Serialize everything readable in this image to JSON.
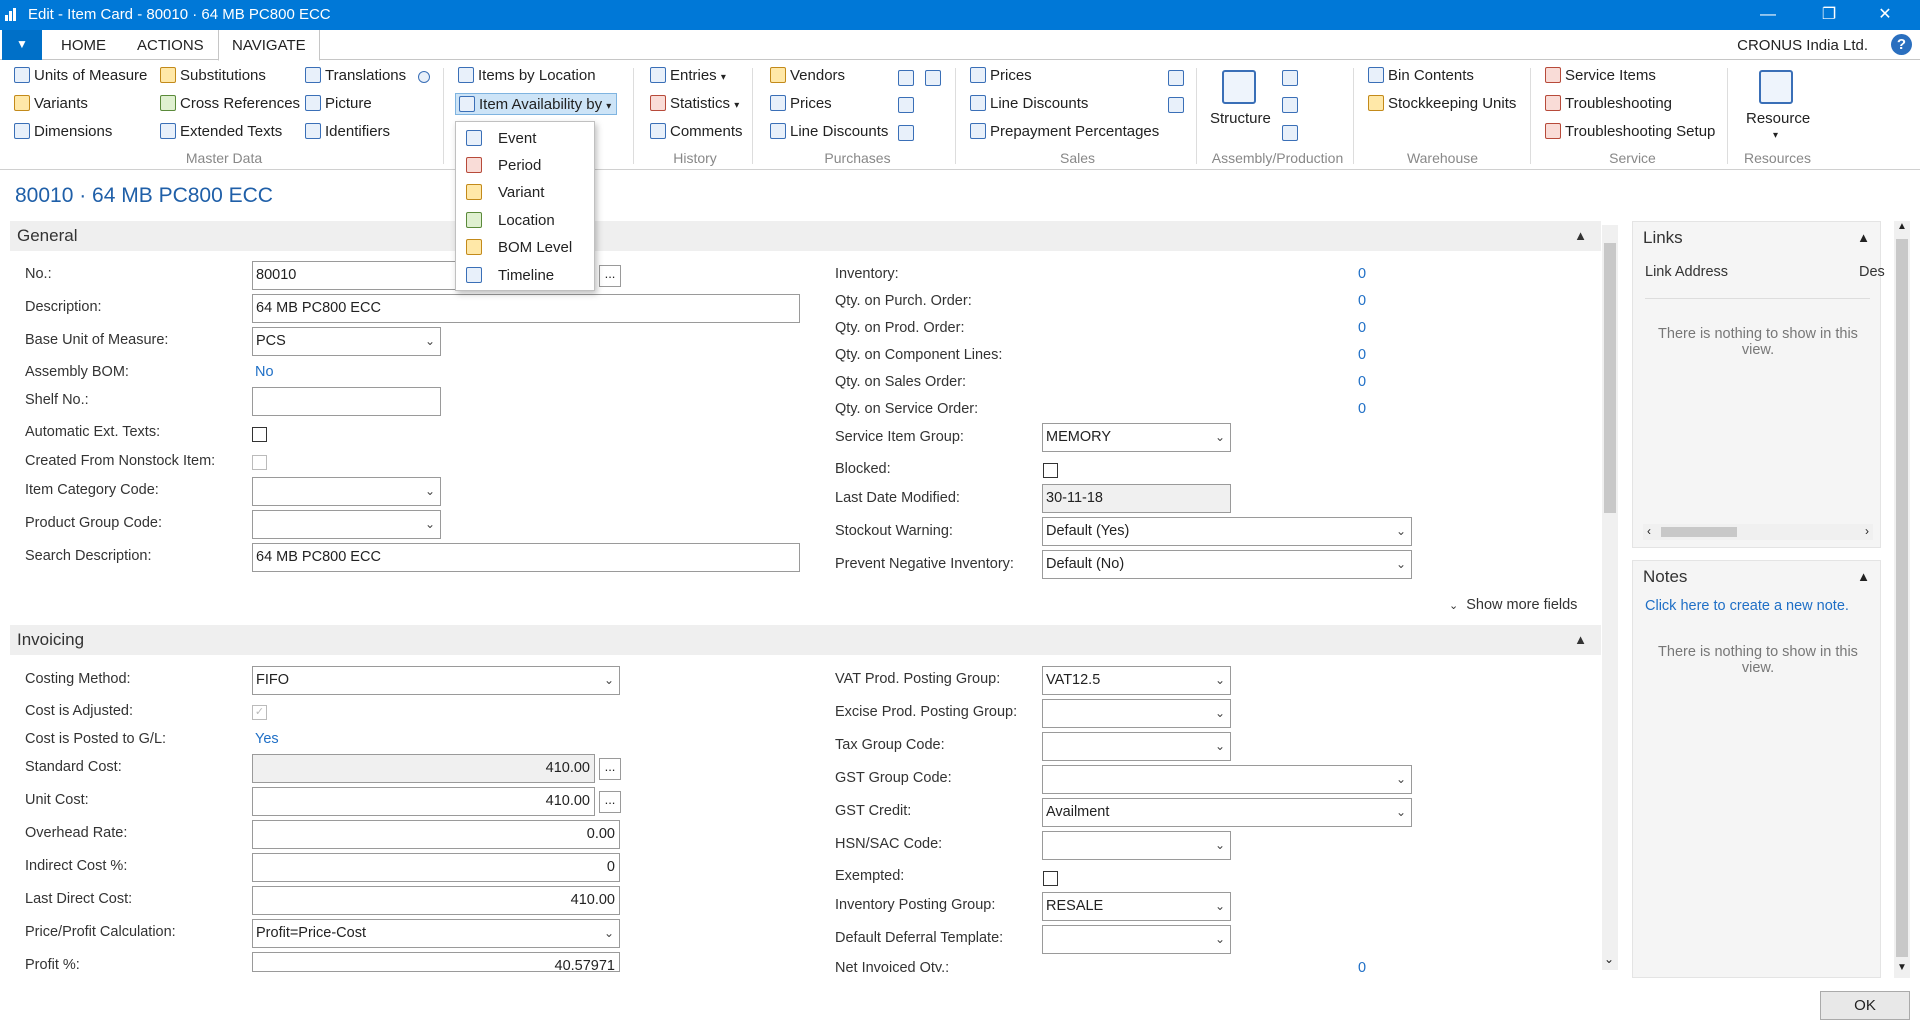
{
  "window": {
    "title": "Edit - Item Card - 80010 · 64 MB PC800 ECC",
    "minimize": "—",
    "restore": "❐",
    "close": "✕"
  },
  "menu": {
    "dropdown": "▼",
    "tabs": [
      "HOME",
      "ACTIONS",
      "NAVIGATE"
    ],
    "company": "CRONUS India Ltd.",
    "help": "?"
  },
  "ribbon": {
    "master_data": {
      "label": "Master Data",
      "items": [
        "Units of Measure",
        "Variants",
        "Dimensions",
        "Substitutions",
        "Cross References",
        "Extended Texts",
        "Translations",
        "Picture",
        "Identifiers"
      ]
    },
    "availability": {
      "items_by_location": "Items by Location",
      "item_availability_by": "Item Availability by"
    },
    "history": {
      "label": "History",
      "items": [
        "Entries",
        "Statistics",
        "Comments"
      ]
    },
    "purchases": {
      "label": "Purchases",
      "items": [
        "Vendors",
        "Prices",
        "Line Discounts"
      ]
    },
    "sales": {
      "label": "Sales",
      "items": [
        "Prices",
        "Line Discounts",
        "Prepayment Percentages"
      ]
    },
    "assembly": {
      "label": "Assembly/Production",
      "structure": "Structure"
    },
    "warehouse": {
      "label": "Warehouse",
      "items": [
        "Bin Contents",
        "Stockkeeping Units"
      ]
    },
    "service": {
      "label": "Service",
      "items": [
        "Service Items",
        "Troubleshooting",
        "Troubleshooting Setup"
      ]
    },
    "resources": {
      "label": "Resources",
      "resource": "Resource"
    }
  },
  "availability_menu": [
    "Event",
    "Period",
    "Variant",
    "Location",
    "BOM Level",
    "Timeline"
  ],
  "page_title": "80010 · 64 MB PC800 ECC",
  "general": {
    "header": "General",
    "no_label": "No.:",
    "no": "80010",
    "description_label": "Description:",
    "description": "64 MB PC800 ECC",
    "base_uom_label": "Base Unit of Measure:",
    "base_uom": "PCS",
    "assembly_bom_label": "Assembly BOM:",
    "assembly_bom": "No",
    "shelf_label": "Shelf No.:",
    "auto_ext_label": "Automatic Ext. Texts:",
    "nonstock_label": "Created From Nonstock Item:",
    "item_cat_label": "Item Category Code:",
    "prod_group_label": "Product Group Code:",
    "search_desc_label": "Search Description:",
    "search_desc": "64 MB PC800 ECC",
    "inventory_label": "Inventory:",
    "inventory": "0",
    "qty_purch_label": "Qty. on Purch. Order:",
    "qty_purch": "0",
    "qty_prod_label": "Qty. on Prod. Order:",
    "qty_prod": "0",
    "qty_comp_label": "Qty. on Component Lines:",
    "qty_comp": "0",
    "qty_sales_label": "Qty. on Sales Order:",
    "qty_sales": "0",
    "qty_service_label": "Qty. on Service Order:",
    "qty_service": "0",
    "service_group_label": "Service Item Group:",
    "service_group": "MEMORY",
    "blocked_label": "Blocked:",
    "last_modified_label": "Last Date Modified:",
    "last_modified": "30-11-18",
    "stockout_label": "Stockout Warning:",
    "stockout": "Default (Yes)",
    "prevent_neg_label": "Prevent Negative Inventory:",
    "prevent_neg": "Default (No)",
    "show_more": "Show more fields"
  },
  "invoicing": {
    "header": "Invoicing",
    "costing_label": "Costing Method:",
    "costing": "FIFO",
    "cost_adjusted_label": "Cost is Adjusted:",
    "cost_posted_label": "Cost is Posted to G/L:",
    "cost_posted": "Yes",
    "std_cost_label": "Standard Cost:",
    "std_cost": "410.00",
    "unit_cost_label": "Unit Cost:",
    "unit_cost": "410.00",
    "overhead_label": "Overhead Rate:",
    "overhead": "0.00",
    "indirect_label": "Indirect Cost %:",
    "indirect": "0",
    "last_direct_label": "Last Direct Cost:",
    "last_direct": "410.00",
    "price_calc_label": "Price/Profit Calculation:",
    "price_calc": "Profit=Price-Cost",
    "profit_label": "Profit %:",
    "profit": "40.57971",
    "vat_label": "VAT Prod. Posting Group:",
    "vat": "VAT12.5",
    "excise_label": "Excise Prod. Posting Group:",
    "tax_group_label": "Tax Group Code:",
    "gst_group_label": "GST Group Code:",
    "gst_credit_label": "GST Credit:",
    "gst_credit": "Availment",
    "hsn_label": "HSN/SAC Code:",
    "exempted_label": "Exempted:",
    "inv_posting_label": "Inventory Posting Group:",
    "inv_posting": "RESALE",
    "deferral_label": "Default Deferral Template:",
    "not_invoiced_label": "Net Invoiced Qty.:",
    "not_invoiced": "0"
  },
  "factbox": {
    "links_title": "Links",
    "link_address": "Link Address",
    "link_desc": "Des",
    "empty": "There is nothing to show in this view.",
    "notes_title": "Notes",
    "create_note": "Click here to create a new note."
  },
  "ok": "OK"
}
